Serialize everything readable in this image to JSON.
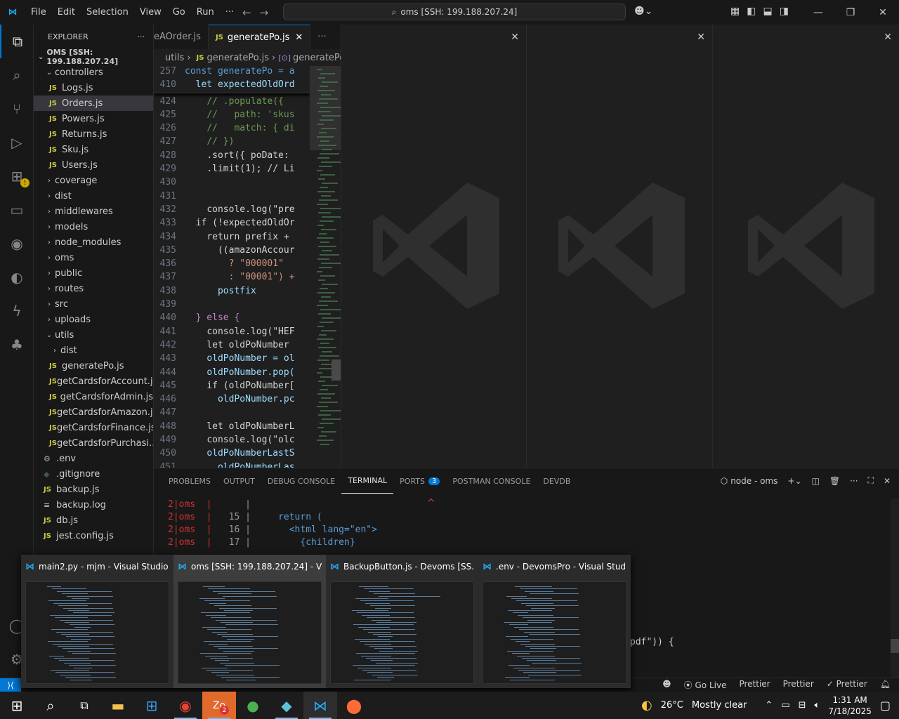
{
  "titlebar": {
    "menus": [
      "File",
      "Edit",
      "Selection",
      "View",
      "Go",
      "Run",
      "···"
    ],
    "search_text": "oms [SSH: 199.188.207.24]"
  },
  "sidebar": {
    "header": "EXPLORER",
    "root": "OMS [SSH: 199.188.207.24]",
    "items": [
      {
        "label": "controllers",
        "type": "folder-open",
        "indent": 1
      },
      {
        "label": "Logs.js",
        "type": "js",
        "indent": 2
      },
      {
        "label": "Orders.js",
        "type": "js",
        "indent": 2,
        "selected": true
      },
      {
        "label": "Powers.js",
        "type": "js",
        "indent": 2
      },
      {
        "label": "Returns.js",
        "type": "js",
        "indent": 2
      },
      {
        "label": "Sku.js",
        "type": "js",
        "indent": 2
      },
      {
        "label": "Users.js",
        "type": "js",
        "indent": 2
      },
      {
        "label": "coverage",
        "type": "folder",
        "indent": 1
      },
      {
        "label": "dist",
        "type": "folder",
        "indent": 1
      },
      {
        "label": "middlewares",
        "type": "folder",
        "indent": 1
      },
      {
        "label": "models",
        "type": "folder",
        "indent": 1
      },
      {
        "label": "node_modules",
        "type": "folder",
        "indent": 1
      },
      {
        "label": "oms",
        "type": "folder",
        "indent": 1
      },
      {
        "label": "public",
        "type": "folder",
        "indent": 1
      },
      {
        "label": "routes",
        "type": "folder",
        "indent": 1
      },
      {
        "label": "src",
        "type": "folder",
        "indent": 1
      },
      {
        "label": "uploads",
        "type": "folder",
        "indent": 1
      },
      {
        "label": "utils",
        "type": "folder-open",
        "indent": 1
      },
      {
        "label": "dist",
        "type": "folder",
        "indent": 2
      },
      {
        "label": "generatePo.js",
        "type": "js",
        "indent": 2
      },
      {
        "label": "getCardsforAccount.js",
        "type": "js",
        "indent": 2
      },
      {
        "label": "getCardsforAdmin.js",
        "type": "js",
        "indent": 2
      },
      {
        "label": "getCardsforAmazon.js",
        "type": "js",
        "indent": 2
      },
      {
        "label": "getCardsforFinance.js",
        "type": "js",
        "indent": 2
      },
      {
        "label": "getCardsforPurchasi...",
        "type": "js",
        "indent": 2
      },
      {
        "label": ".env",
        "type": "gear",
        "indent": 1
      },
      {
        "label": ".gitignore",
        "type": "git",
        "indent": 1
      },
      {
        "label": "backup.js",
        "type": "js",
        "indent": 1
      },
      {
        "label": "backup.log",
        "type": "lines",
        "indent": 1
      },
      {
        "label": "db.js",
        "type": "js",
        "indent": 1
      },
      {
        "label": "jest.config.js",
        "type": "js",
        "indent": 1
      }
    ]
  },
  "editor": {
    "tabs": [
      {
        "label": "eAOrder.js",
        "active": false
      },
      {
        "label": "generatePo.js",
        "active": true
      }
    ],
    "breadcrumb": [
      "utils",
      "generatePo.js",
      "generatePo"
    ],
    "sticky": [
      {
        "num": "257",
        "text": "const generatePo = a"
      },
      {
        "num": "410",
        "text": "  let expectedOldOrd"
      }
    ],
    "lines": [
      {
        "num": "424",
        "indent": "    ",
        "code": "// .populate({",
        "cls": "cm"
      },
      {
        "num": "425",
        "indent": "    ",
        "code": "//   path: 'skus",
        "cls": "cm"
      },
      {
        "num": "426",
        "indent": "    ",
        "code": "//   match: { di",
        "cls": "cm"
      },
      {
        "num": "427",
        "indent": "    ",
        "code": "// })",
        "cls": "cm"
      },
      {
        "num": "428",
        "indent": "    ",
        "code": ".sort({ poDate: ",
        "cls": "pl"
      },
      {
        "num": "429",
        "indent": "    ",
        "code": ".limit(1); // Li",
        "cls": "pl"
      },
      {
        "num": "430",
        "indent": "",
        "code": "",
        "cls": "pl"
      },
      {
        "num": "431",
        "indent": "",
        "code": "",
        "cls": "pl"
      },
      {
        "num": "432",
        "indent": "    ",
        "code": "console.log(\"pre",
        "cls": "pl"
      },
      {
        "num": "433",
        "indent": "  ",
        "code": "if (!expectedOldOr",
        "cls": "pl"
      },
      {
        "num": "434",
        "indent": "    ",
        "code": "return prefix + ",
        "cls": "pl"
      },
      {
        "num": "435",
        "indent": "      ",
        "code": "((amazonAccour",
        "cls": "pl"
      },
      {
        "num": "436",
        "indent": "        ",
        "code": "? \"000001\"",
        "cls": "str"
      },
      {
        "num": "437",
        "indent": "        ",
        "code": ": \"00001\") +",
        "cls": "str"
      },
      {
        "num": "438",
        "indent": "      ",
        "code": "postfix",
        "cls": "var"
      },
      {
        "num": "439",
        "indent": "",
        "code": "",
        "cls": "pl"
      },
      {
        "num": "440",
        "indent": "  ",
        "code": "} else {",
        "cls": "kc"
      },
      {
        "num": "441",
        "indent": "    ",
        "code": "console.log(\"HEF",
        "cls": "pl"
      },
      {
        "num": "442",
        "indent": "    ",
        "code": "let oldPoNumber ",
        "cls": "pl"
      },
      {
        "num": "443",
        "indent": "    ",
        "code": "oldPoNumber = ol",
        "cls": "var"
      },
      {
        "num": "444",
        "indent": "    ",
        "code": "oldPoNumber.pop(",
        "cls": "var"
      },
      {
        "num": "445",
        "indent": "    ",
        "code": "if (oldPoNumber[",
        "cls": "pl"
      },
      {
        "num": "446",
        "indent": "      ",
        "code": "oldPoNumber.pc",
        "cls": "var"
      },
      {
        "num": "447",
        "indent": "",
        "code": "",
        "cls": "pl"
      },
      {
        "num": "448",
        "indent": "    ",
        "code": "let oldPoNumberL",
        "cls": "pl"
      },
      {
        "num": "449",
        "indent": "    ",
        "code": "console.log(\"olc",
        "cls": "pl"
      },
      {
        "num": "450",
        "indent": "    ",
        "code": "oldPoNumberLastS",
        "cls": "var"
      },
      {
        "num": "451",
        "indent": "      ",
        "code": "oldPoNumberLas",
        "cls": "var"
      }
    ]
  },
  "panel": {
    "tabs": [
      "PROBLEMS",
      "OUTPUT",
      "DEBUG CONSOLE",
      "TERMINAL",
      "PORTS",
      "POSTMAN CONSOLE",
      "DEVDB"
    ],
    "active_tab": "TERMINAL",
    "ports_badge": "3",
    "terminal_name": "node - oms",
    "terminal_lines": [
      {
        "prefix": "2|oms",
        "num": "",
        "code": ""
      },
      {
        "prefix": "2|oms",
        "num": "15",
        "code": "    return ("
      },
      {
        "prefix": "2|oms",
        "num": "16",
        "code": "      <html lang=\"en\">"
      },
      {
        "prefix": "2|oms",
        "num": "17",
        "code": "        {children}"
      }
    ],
    "caret": "^",
    "partial_right": "pdf\")) {"
  },
  "statusbar": {
    "items": [
      "Go Live",
      "Prettier",
      "Prettier",
      "Prettier"
    ]
  },
  "thumbnails": [
    {
      "title": "main2.py - mjm - Visual Studio ..."
    },
    {
      "title": "oms [SSH: 199.188.207.24] - Vis..."
    },
    {
      "title": "BackupButton.js - Devoms [SS..."
    },
    {
      "title": ".env - DevomsPro - Visual Studi..."
    }
  ],
  "taskbar": {
    "weather_temp": "26°C",
    "weather_desc": "Mostly clear",
    "time": "1:31 AM",
    "date": "7/18/2025",
    "zoom_badge": "2"
  }
}
